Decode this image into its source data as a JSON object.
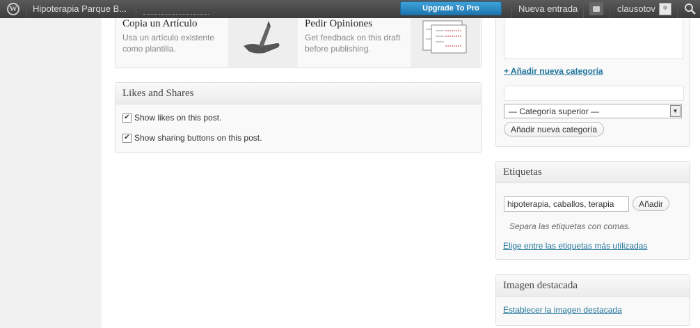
{
  "adminbar": {
    "site_name": "Hipoterapia Parque B...",
    "upgrade_label": "Upgrade To Pro",
    "new_post_label": "Nueva entrada",
    "username": "clausotov"
  },
  "templates": {
    "copy": {
      "title": "Copia un Artículo",
      "desc_1": "Usa un artículo existente",
      "desc_2": "como plantilla."
    },
    "feedback": {
      "title": "Pedir Opiniones",
      "desc_1": "Get feedback on this draft",
      "desc_2": "before publishing."
    }
  },
  "likes": {
    "title": "Likes and Shares",
    "show_likes": "Show likes on this post.",
    "show_sharing": "Show sharing buttons on this post."
  },
  "categories": {
    "add_link": "+ Añadir nueva categoría",
    "new_category_value": "",
    "parent_select": "— Categoría superior —",
    "add_button": "Añadir nueva categoría"
  },
  "tags": {
    "title": "Etiquetas",
    "input_value": "hipoterapia, caballos, terapia",
    "add_button": "Añadir",
    "hint": "Separa las etiquetas con comas.",
    "choose_link": "Elige entre las etiquetas más utilizadas"
  },
  "featured": {
    "title": "Imagen destacada",
    "set_link": "Establecer la imagen destacada"
  }
}
